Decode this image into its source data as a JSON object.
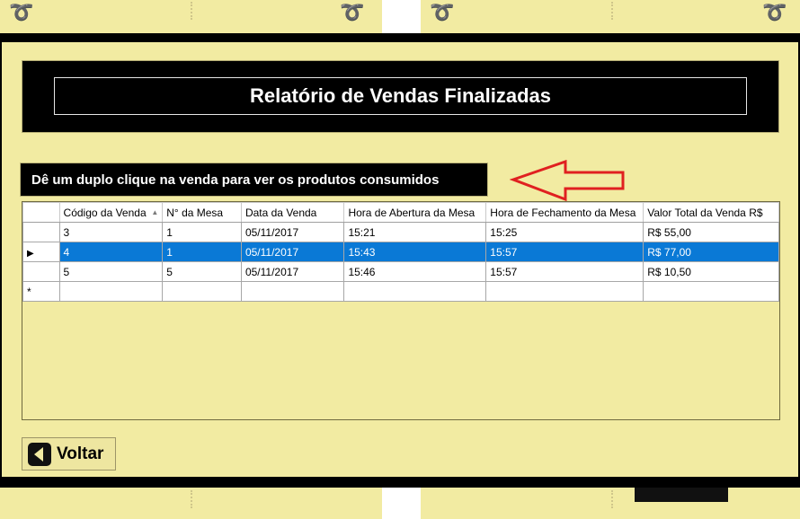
{
  "title": "Relatório de Vendas Finalizadas",
  "hint": "Dê um duplo clique na venda para ver os produtos consumidos",
  "grid": {
    "columns": [
      "Código da Venda",
      "N° da Mesa",
      "Data da Venda",
      "Hora de Abertura da Mesa",
      "Hora de Fechamento da Mesa",
      "Valor Total da Venda R$"
    ],
    "rows": [
      [
        "3",
        "1",
        "05/11/2017",
        "15:21",
        "15:25",
        "R$ 55,00"
      ],
      [
        "4",
        "1",
        "05/11/2017",
        "15:43",
        "15:57",
        "R$ 77,00"
      ],
      [
        "5",
        "5",
        "05/11/2017",
        "15:46",
        "15:57",
        "R$ 10,50"
      ]
    ],
    "selected_row": 2,
    "new_row_marker": "*",
    "current_row_marker": "▶"
  },
  "back_button": "Voltar",
  "colors": {
    "form_bg": "#f2eba2",
    "header_bg": "#000000",
    "selection": "#0a79d6",
    "arrow": "#e02020"
  }
}
